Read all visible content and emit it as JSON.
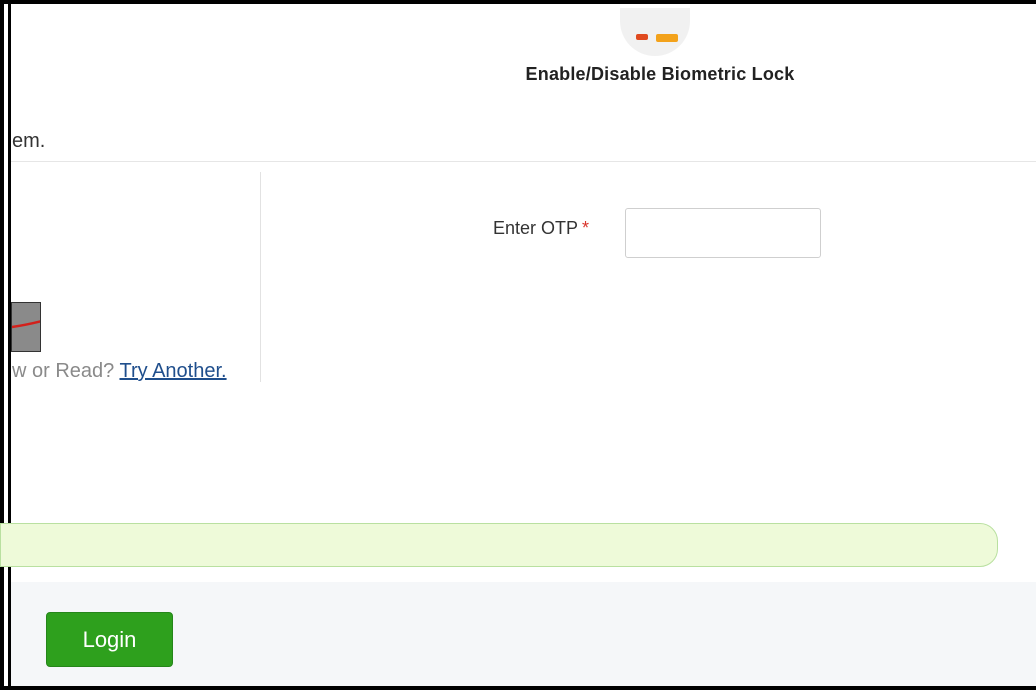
{
  "biometric": {
    "title": "Enable/Disable Biometric Lock"
  },
  "intro": {
    "partial_text": "em."
  },
  "captcha": {
    "help_prefix": "w or Read?",
    "try_another_link": "Try Another."
  },
  "otp": {
    "label": "Enter OTP",
    "required_marker": "*",
    "value": "",
    "placeholder": ""
  },
  "actions": {
    "login_label": "Login"
  },
  "colors": {
    "login_button": "#2ea01d",
    "success_bar": "#eefad9",
    "link": "#1f4e8c",
    "required": "#d9342b"
  }
}
